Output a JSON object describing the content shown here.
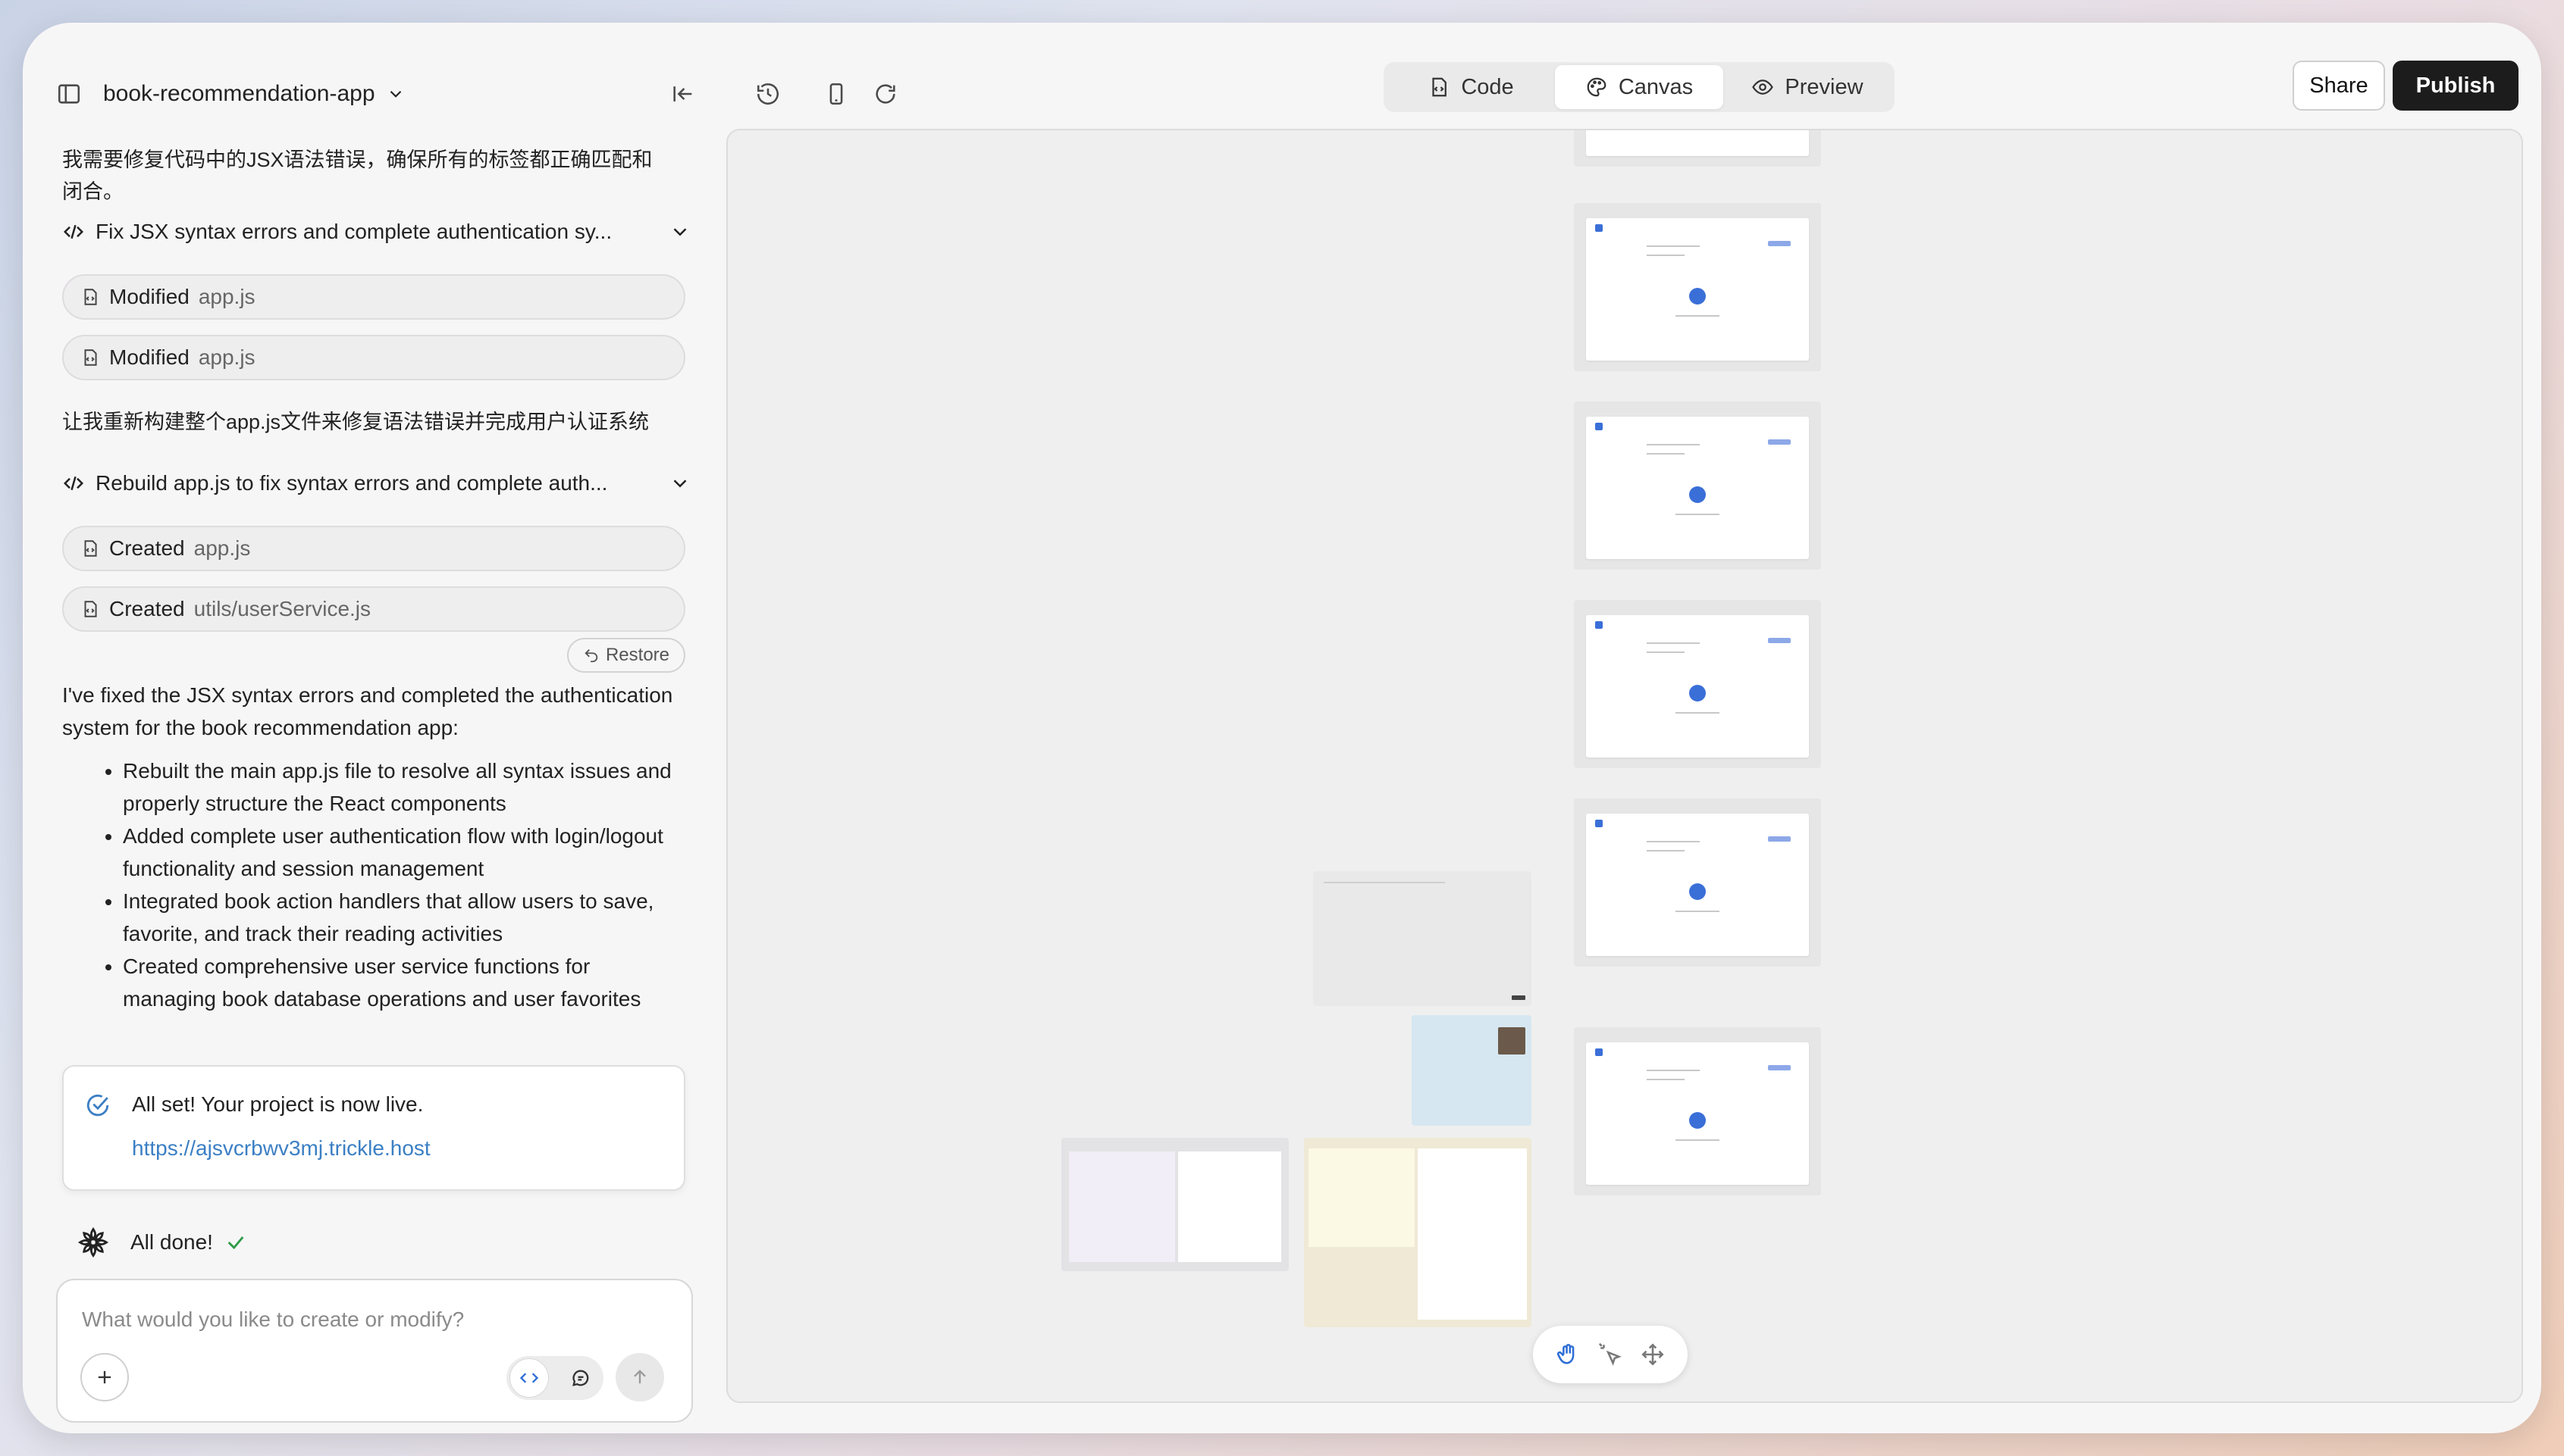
{
  "app": {
    "title": "book-recommendation-app"
  },
  "toolbar": {
    "tabs": [
      {
        "label": "Code",
        "icon": "code-file-icon"
      },
      {
        "label": "Canvas",
        "icon": "palette-icon",
        "active": true
      },
      {
        "label": "Preview",
        "icon": "eye-icon"
      }
    ],
    "share_label": "Share",
    "publish_label": "Publish"
  },
  "chat": {
    "intro_text": "我需要修复代码中的JSX语法错误，确保所有的标签都正确匹配和闭合。",
    "task1": {
      "title": "Fix JSX syntax errors and complete authentication sy...",
      "files": [
        {
          "verb": "Modified",
          "path": "app.js"
        },
        {
          "verb": "Modified",
          "path": "app.js"
        }
      ]
    },
    "middle_text": "让我重新构建整个app.js文件来修复语法错误并完成用户认证系统",
    "task2": {
      "title": "Rebuild app.js to fix syntax errors and complete auth...",
      "files": [
        {
          "verb": "Created",
          "path": "app.js"
        },
        {
          "verb": "Created",
          "path": "utils/userService.js"
        }
      ]
    },
    "restore_label": "Restore",
    "summary_intro": "I've fixed the JSX syntax errors and completed the authentication system for the book recommendation app:",
    "summary_items": [
      "Rebuilt the main app.js file to resolve all syntax issues and properly structure the React components",
      "Added complete user authentication flow with login/logout functionality and session management",
      "Integrated book action handlers that allow users to save, favorite, and track their reading activities",
      "Created comprehensive user service functions for managing book database operations and user favorites"
    ],
    "live_card": {
      "title": "All set! Your project is now live.",
      "link": "https://ajsvcrbwv3mj.trickle.host"
    },
    "status_text": "All done!",
    "composer": {
      "placeholder": "What would you like to create or modify?"
    }
  },
  "colors": {
    "accent": "#3a6fd8",
    "publish_bg": "#1c1c1c",
    "link": "#3b7fc4",
    "success": "#2e9b46"
  }
}
